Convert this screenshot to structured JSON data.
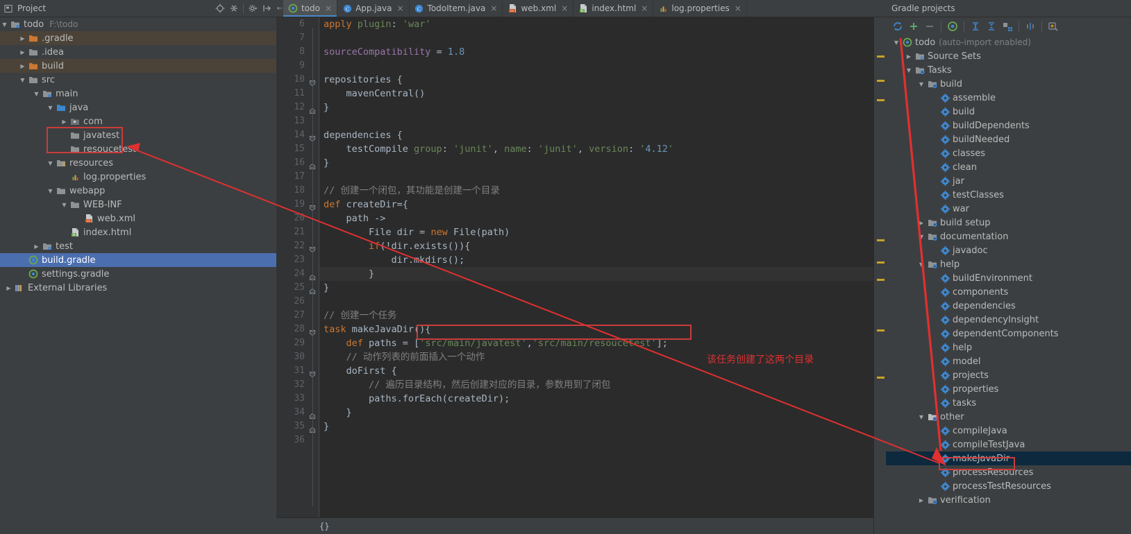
{
  "project_panel": {
    "title": "Project",
    "title_icon": "project-view-icon",
    "dropdown_icon": "chevron-down-icon",
    "toolbar_icons": [
      "locate-target-icon",
      "collapse-all-icon",
      "settings-gear-icon",
      "hide-panel-icon"
    ],
    "root": {
      "label": "todo",
      "path": "F:\\todo"
    },
    "tree": [
      {
        "label": ".gradle",
        "indent": 1,
        "arrow": "collapsed",
        "icon": "folder-orange",
        "highlight": "brown"
      },
      {
        "label": ".idea",
        "indent": 1,
        "arrow": "collapsed",
        "icon": "folder-gray",
        "highlight": "none"
      },
      {
        "label": "build",
        "indent": 1,
        "arrow": "collapsed",
        "icon": "folder-orange",
        "highlight": "brown"
      },
      {
        "label": "src",
        "indent": 1,
        "arrow": "expanded",
        "icon": "folder-gray",
        "highlight": "none"
      },
      {
        "label": "main",
        "indent": 2,
        "arrow": "expanded",
        "icon": "folder-module",
        "highlight": "none"
      },
      {
        "label": "java",
        "indent": 3,
        "arrow": "expanded",
        "icon": "folder-blue",
        "highlight": "none"
      },
      {
        "label": "com",
        "indent": 4,
        "arrow": "collapsed",
        "icon": "folder-package",
        "highlight": "none"
      },
      {
        "label": "javatest",
        "indent": 4,
        "arrow": "none",
        "icon": "folder-gray",
        "highlight": "none"
      },
      {
        "label": "resoucetest",
        "indent": 4,
        "arrow": "none",
        "icon": "folder-gray",
        "highlight": "none"
      },
      {
        "label": "resources",
        "indent": 3,
        "arrow": "expanded",
        "icon": "folder-resources",
        "highlight": "none"
      },
      {
        "label": "log.properties",
        "indent": 4,
        "arrow": "none",
        "icon": "file-properties",
        "highlight": "none"
      },
      {
        "label": "webapp",
        "indent": 3,
        "arrow": "expanded",
        "icon": "folder-gray",
        "highlight": "none"
      },
      {
        "label": "WEB-INF",
        "indent": 4,
        "arrow": "expanded",
        "icon": "folder-gray",
        "highlight": "none"
      },
      {
        "label": "web.xml",
        "indent": 5,
        "arrow": "none",
        "icon": "file-xml",
        "highlight": "none"
      },
      {
        "label": "index.html",
        "indent": 4,
        "arrow": "none",
        "icon": "file-html",
        "highlight": "none"
      },
      {
        "label": "test",
        "indent": 2,
        "arrow": "collapsed",
        "icon": "folder-module",
        "highlight": "none"
      },
      {
        "label": "build.gradle",
        "indent": 1,
        "arrow": "none",
        "icon": "file-gradle",
        "highlight": "selected"
      },
      {
        "label": "settings.gradle",
        "indent": 1,
        "arrow": "none",
        "icon": "file-gradle",
        "highlight": "none"
      },
      {
        "label": "External Libraries",
        "indent": 0,
        "arrow": "collapsed",
        "icon": "libraries",
        "highlight": "none"
      }
    ],
    "red_box_items": [
      "javatest",
      "resoucetest"
    ]
  },
  "editor": {
    "tabs": [
      {
        "label": "todo",
        "icon": "gradle-icon",
        "active": true,
        "close": "×"
      },
      {
        "label": "App.java",
        "icon": "java-class-icon",
        "active": false,
        "close": "×"
      },
      {
        "label": "TodoItem.java",
        "icon": "java-class-icon",
        "active": false,
        "close": "×"
      },
      {
        "label": "web.xml",
        "icon": "xml-file-icon",
        "active": false,
        "close": "×"
      },
      {
        "label": "index.html",
        "icon": "html-file-icon",
        "active": false,
        "close": "×"
      },
      {
        "label": "log.properties",
        "icon": "properties-icon",
        "active": false,
        "close": "×"
      }
    ],
    "first_line_number": 6,
    "line_numbers": [
      6,
      7,
      8,
      9,
      10,
      11,
      12,
      13,
      14,
      15,
      16,
      17,
      18,
      19,
      20,
      21,
      22,
      23,
      24,
      25,
      26,
      27,
      28,
      29,
      30,
      31,
      32,
      33,
      34,
      35,
      36
    ],
    "code_lines": [
      "apply plugin: 'war'",
      "",
      "sourceCompatibility = 1.8",
      "",
      "repositories {",
      "    mavenCentral()",
      "}",
      "",
      "dependencies {",
      "    testCompile group: 'junit', name: 'junit', version: '4.12'",
      "}",
      "",
      "// 创建一个闭包，其功能是创建一个目录",
      "def createDir={",
      "    path ->",
      "        File dir = new File(path)",
      "        if(!dir.exists()){",
      "            dir.mkdirs();",
      "        }",
      "}",
      "",
      "// 创建一个任务",
      "task makeJavaDir(){",
      "    def paths = ['src/main/javatest','src/main/resoucetest'];",
      "    // 动作列表的前面插入一个动作",
      "    doFirst {",
      "        // 遍历目录结构，然后创建对应的目录，参数用到了闭包",
      "        paths.forEach(createDir);",
      "    }",
      "}",
      ""
    ],
    "status_bar_text": "{}",
    "caret_line_number": 24
  },
  "annotations": {
    "code_note": "该任务创建了这两个目录",
    "color": "#e03030",
    "arrow_from_gradle_to_tree": true,
    "arrow_from_note_to_task": true
  },
  "gradle_panel": {
    "title": "Gradle projects",
    "toolbar_icons": [
      "refresh-icon",
      "add-icon",
      "remove-icon",
      "execute-gradle-task-icon",
      "expand-all-icon",
      "collapse-all-icon",
      "toggle-offline-icon",
      "skip-tests-icon",
      "gradle-settings-icon"
    ],
    "tree": [
      {
        "label": "todo",
        "suffix": "(auto-import enabled)",
        "indent": 0,
        "arrow": "expanded",
        "icon": "gradle-icon"
      },
      {
        "label": "Source Sets",
        "suffix": "",
        "indent": 1,
        "arrow": "collapsed",
        "icon": "source-sets-icon"
      },
      {
        "label": "Tasks",
        "suffix": "",
        "indent": 1,
        "arrow": "expanded",
        "icon": "tasks-folder-icon"
      },
      {
        "label": "build",
        "suffix": "",
        "indent": 2,
        "arrow": "expanded",
        "icon": "tasks-folder-icon"
      },
      {
        "label": "assemble",
        "suffix": "",
        "indent": 3,
        "arrow": "none",
        "icon": "gear-task-icon"
      },
      {
        "label": "build",
        "suffix": "",
        "indent": 3,
        "arrow": "none",
        "icon": "gear-task-icon"
      },
      {
        "label": "buildDependents",
        "suffix": "",
        "indent": 3,
        "arrow": "none",
        "icon": "gear-task-icon"
      },
      {
        "label": "buildNeeded",
        "suffix": "",
        "indent": 3,
        "arrow": "none",
        "icon": "gear-task-icon"
      },
      {
        "label": "classes",
        "suffix": "",
        "indent": 3,
        "arrow": "none",
        "icon": "gear-task-icon"
      },
      {
        "label": "clean",
        "suffix": "",
        "indent": 3,
        "arrow": "none",
        "icon": "gear-task-icon"
      },
      {
        "label": "jar",
        "suffix": "",
        "indent": 3,
        "arrow": "none",
        "icon": "gear-task-icon"
      },
      {
        "label": "testClasses",
        "suffix": "",
        "indent": 3,
        "arrow": "none",
        "icon": "gear-task-icon"
      },
      {
        "label": "war",
        "suffix": "",
        "indent": 3,
        "arrow": "none",
        "icon": "gear-task-icon"
      },
      {
        "label": "build setup",
        "suffix": "",
        "indent": 2,
        "arrow": "collapsed",
        "icon": "tasks-folder-icon"
      },
      {
        "label": "documentation",
        "suffix": "",
        "indent": 2,
        "arrow": "expanded",
        "icon": "tasks-folder-icon"
      },
      {
        "label": "javadoc",
        "suffix": "",
        "indent": 3,
        "arrow": "none",
        "icon": "gear-task-icon"
      },
      {
        "label": "help",
        "suffix": "",
        "indent": 2,
        "arrow": "expanded",
        "icon": "tasks-folder-icon"
      },
      {
        "label": "buildEnvironment",
        "suffix": "",
        "indent": 3,
        "arrow": "none",
        "icon": "gear-task-icon"
      },
      {
        "label": "components",
        "suffix": "",
        "indent": 3,
        "arrow": "none",
        "icon": "gear-task-icon"
      },
      {
        "label": "dependencies",
        "suffix": "",
        "indent": 3,
        "arrow": "none",
        "icon": "gear-task-icon"
      },
      {
        "label": "dependencyInsight",
        "suffix": "",
        "indent": 3,
        "arrow": "none",
        "icon": "gear-task-icon"
      },
      {
        "label": "dependentComponents",
        "suffix": "",
        "indent": 3,
        "arrow": "none",
        "icon": "gear-task-icon"
      },
      {
        "label": "help",
        "suffix": "",
        "indent": 3,
        "arrow": "none",
        "icon": "gear-task-icon"
      },
      {
        "label": "model",
        "suffix": "",
        "indent": 3,
        "arrow": "none",
        "icon": "gear-task-icon"
      },
      {
        "label": "projects",
        "suffix": "",
        "indent": 3,
        "arrow": "none",
        "icon": "gear-task-icon"
      },
      {
        "label": "properties",
        "suffix": "",
        "indent": 3,
        "arrow": "none",
        "icon": "gear-task-icon"
      },
      {
        "label": "tasks",
        "suffix": "",
        "indent": 3,
        "arrow": "none",
        "icon": "gear-task-icon"
      },
      {
        "label": "other",
        "suffix": "",
        "indent": 2,
        "arrow": "expanded",
        "icon": "other-folder-icon"
      },
      {
        "label": "compileJava",
        "suffix": "",
        "indent": 3,
        "arrow": "none",
        "icon": "gear-task-icon"
      },
      {
        "label": "compileTestJava",
        "suffix": "",
        "indent": 3,
        "arrow": "none",
        "icon": "gear-task-icon"
      },
      {
        "label": "makeJavaDir",
        "suffix": "",
        "indent": 3,
        "arrow": "none",
        "icon": "gear-task-icon",
        "selected": true
      },
      {
        "label": "processResources",
        "suffix": "",
        "indent": 3,
        "arrow": "none",
        "icon": "gear-task-icon"
      },
      {
        "label": "processTestResources",
        "suffix": "",
        "indent": 3,
        "arrow": "none",
        "icon": "gear-task-icon"
      },
      {
        "label": "verification",
        "suffix": "",
        "indent": 2,
        "arrow": "collapsed",
        "icon": "tasks-folder-icon"
      }
    ],
    "highlighted_task": "makeJavaDir"
  },
  "colors": {
    "panel_bg": "#3c3f41",
    "editor_bg": "#2b2b2b",
    "selection_blue": "#4b6eaf",
    "gradle_selection": "#0d293e",
    "annotation_red": "#e03030",
    "string_green": "#6a8759",
    "keyword_orange": "#cc7832",
    "number_blue": "#6897bb"
  }
}
